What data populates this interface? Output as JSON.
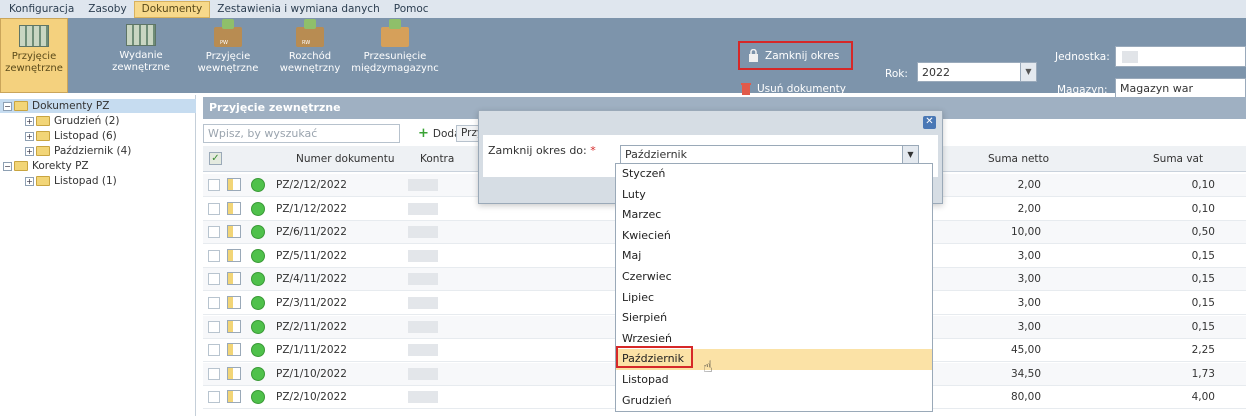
{
  "menubar": {
    "items": [
      "Konfiguracja",
      "Zasoby",
      "Dokumenty",
      "Zestawienia i wymiana danych",
      "Pomoc"
    ],
    "active_index": 2
  },
  "ribbon": {
    "buttons": [
      {
        "label1": "Przyjęcie",
        "label2": "zewnętrzne",
        "icon": "grid-in-icon"
      },
      {
        "label1": "Wydanie",
        "label2": "zewnętrzne",
        "icon": "grid-out-icon"
      },
      {
        "label1": "Przyjęcie",
        "label2": "wewnętrzne",
        "icon": "box-pw-icon",
        "tag": "PW"
      },
      {
        "label1": "Rozchód",
        "label2": "wewnętrzny",
        "icon": "box-rw-icon",
        "tag": "RW"
      },
      {
        "label1": "Przesunięcie",
        "label2": "międzymagazync",
        "icon": "transfer-icon"
      }
    ],
    "active_index": 0,
    "lock_label": "Zamknij okres",
    "delete_label": "Usuń dokumenty",
    "rok_label": "Rok:",
    "rok_value": "2022",
    "jednostka_label": "Jednostka:",
    "magazyn_label": "Magazyn:",
    "magazyn_value": "Magazyn war"
  },
  "tree": {
    "items": [
      {
        "label": "Dokumenty PZ",
        "level": 0,
        "expander": "−",
        "selected": true
      },
      {
        "label": "Grudzień (2)",
        "level": 1,
        "expander": "+"
      },
      {
        "label": "Listopad (6)",
        "level": 1,
        "expander": "+"
      },
      {
        "label": "Październik (4)",
        "level": 1,
        "expander": "+"
      },
      {
        "label": "Korekty PZ",
        "level": 0,
        "expander": "−"
      },
      {
        "label": "Listopad (1)",
        "level": 1,
        "expander": "+"
      }
    ]
  },
  "panel": {
    "title": "Przyjęcie zewnętrzne",
    "search_placeholder": "Wpisz, by wyszukać",
    "add_label": "Dodaj",
    "przy_label": "Przy"
  },
  "grid": {
    "headers": {
      "number": "Numer dokumentu",
      "contractor": "Kontra",
      "netto": "Suma netto",
      "vat": "Suma vat"
    },
    "rows": [
      {
        "number": "PZ/2/12/2022",
        "netto": "2,00",
        "vat": "0,10"
      },
      {
        "number": "PZ/1/12/2022",
        "netto": "2,00",
        "vat": "0,10"
      },
      {
        "number": "PZ/6/11/2022",
        "netto": "10,00",
        "vat": "0,50"
      },
      {
        "number": "PZ/5/11/2022",
        "netto": "3,00",
        "vat": "0,15"
      },
      {
        "number": "PZ/4/11/2022",
        "netto": "3,00",
        "vat": "0,15"
      },
      {
        "number": "PZ/3/11/2022",
        "netto": "3,00",
        "vat": "0,15"
      },
      {
        "number": "PZ/2/11/2022",
        "netto": "3,00",
        "vat": "0,15"
      },
      {
        "number": "PZ/1/11/2022",
        "netto": "45,00",
        "vat": "2,25"
      },
      {
        "number": "PZ/1/10/2022",
        "netto": "34,50",
        "vat": "1,73"
      },
      {
        "number": "PZ/2/10/2022",
        "netto": "80,00",
        "vat": "4,00"
      }
    ]
  },
  "modal": {
    "label": "Zamknij okres do:",
    "required_mark": "*",
    "selected_value": "Październik",
    "close_glyph": "✕"
  },
  "dropdown": {
    "options": [
      "Styczeń",
      "Luty",
      "Marzec",
      "Kwiecień",
      "Maj",
      "Czerwiec",
      "Lipiec",
      "Sierpień",
      "Wrzesień",
      "Październik",
      "Listopad",
      "Grudzień"
    ],
    "hover_index": 9
  },
  "colors": {
    "ribbon_bg": "#7d94ab",
    "active_tab": "#f4d17e",
    "highlight_border": "#d62828",
    "status_ok": "#4fc14b"
  }
}
